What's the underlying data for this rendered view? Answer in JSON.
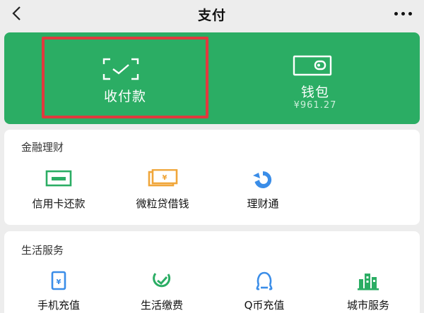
{
  "header": {
    "title": "支付",
    "back_icon": "chevron-left-icon",
    "more_icon": "more-horizontal-icon"
  },
  "colors": {
    "accent_green": "#2bad64",
    "highlight_red": "#e03a3e",
    "icon_green": "#2bad64",
    "icon_orange": "#f0a63a",
    "icon_blue": "#3a8de8"
  },
  "top_panel": {
    "pay": {
      "label": "收付款",
      "icon": "scan-pay-icon"
    },
    "wallet": {
      "label": "钱包",
      "balance": "¥961.27",
      "icon": "wallet-icon"
    }
  },
  "finance": {
    "title": "金融理财",
    "items": [
      {
        "label": "信用卡还款",
        "icon": "credit-card-icon"
      },
      {
        "label": "微粒贷借钱",
        "icon": "loan-yuan-icon"
      },
      {
        "label": "理财通",
        "icon": "wealth-icon"
      }
    ],
    "loan_symbol": "¥"
  },
  "life": {
    "title": "生活服务",
    "items": [
      {
        "label": "手机充值",
        "icon": "phone-topup-icon"
      },
      {
        "label": "生活缴费",
        "icon": "utility-payment-icon"
      },
      {
        "label": "Q币充值",
        "icon": "qq-coin-icon"
      },
      {
        "label": "城市服务",
        "icon": "city-service-icon"
      }
    ],
    "phone_symbol": "¥"
  }
}
